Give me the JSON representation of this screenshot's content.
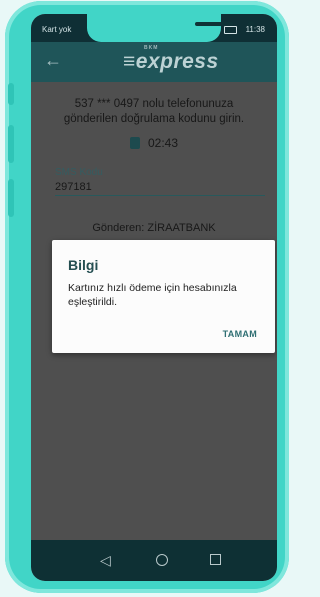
{
  "status_bar": {
    "carrier": "Kart yok",
    "time": "11:38"
  },
  "app_bar": {
    "logo_small": "BKM",
    "logo": "≡express"
  },
  "verification": {
    "message_line1": "537 *** 0497 nolu telefonunuza",
    "message_line2": "gönderilen doğrulama kodunu girin.",
    "timer": "02:43",
    "sms_label": "SMS Kodu",
    "sms_value": "297181",
    "sender": "Gönderen: ZİRAATBANK"
  },
  "dialog": {
    "title": "Bilgi",
    "text": "Kartınız hızlı ödeme için hesabınızla eşleştirildi.",
    "ok_label": "TAMAM"
  },
  "navbar": {
    "icons": [
      "back-icon",
      "home-icon",
      "recents-icon"
    ]
  },
  "colors": {
    "phone_frame": "#41d5c7",
    "app_bar": "#1f5559",
    "dialog_title": "#244e51"
  }
}
